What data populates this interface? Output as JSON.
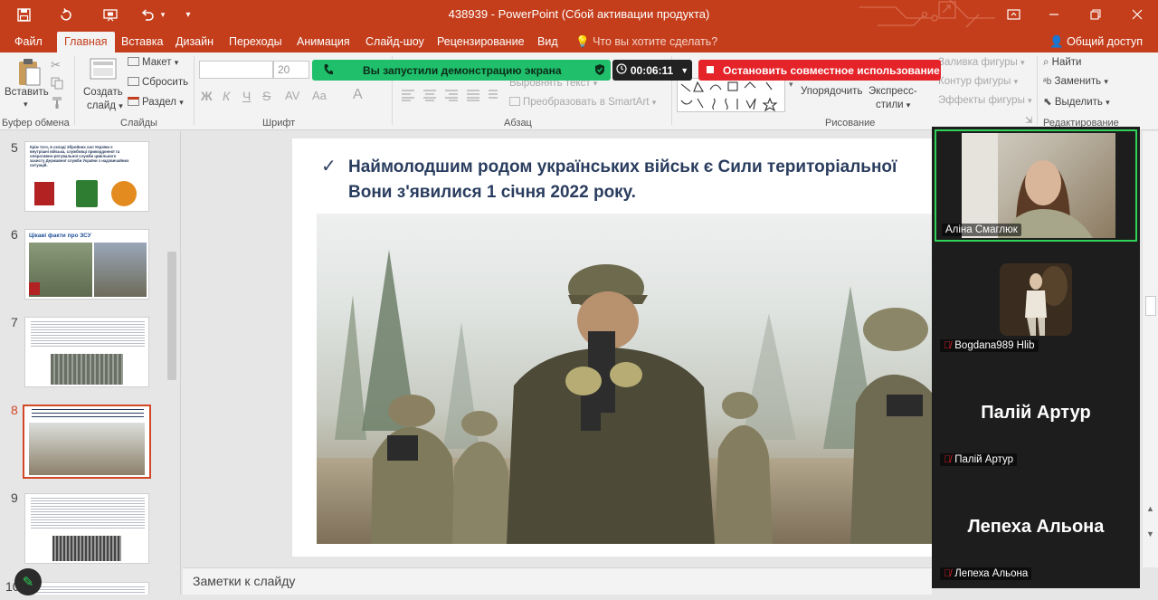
{
  "window": {
    "title": "438939  -  PowerPoint (Сбой активации продукта)",
    "share_access": "Общий доступ"
  },
  "tabs": [
    "Файл",
    "Главная",
    "Вставка",
    "Дизайн",
    "Переходы",
    "Анимация",
    "Слайд-шоу",
    "Рецензирование",
    "Вид"
  ],
  "tell_me": "Что вы хотите сделать?",
  "ribbon": {
    "paste": "Вставить",
    "clipboard": "Буфер обмена",
    "new_slide_line1": "Создать",
    "new_slide_line2": "слайд",
    "layout": "Макет",
    "reset": "Сбросить",
    "section": "Раздел",
    "slides": "Слайды",
    "font_size": "20",
    "font_group": "Шрифт",
    "bold": "Ж",
    "italic": "К",
    "underline": "Ч",
    "text_direction": "Выровнять текст",
    "smartart": "Преобразовать в SmartArt",
    "paragraph": "Абзац",
    "arrange": "Упорядочить",
    "quick_styles_line1": "Экспресс-",
    "quick_styles_line2": "стили",
    "shape_fill": "Заливка фигуры",
    "shape_outline": "Контур фигуры",
    "shape_effects": "Эффекты фигуры",
    "drawing": "Рисование",
    "find": "Найти",
    "replace": "Заменить",
    "select": "Выделить",
    "editing": "Редактирование"
  },
  "share_banner": {
    "message": "Вы запустили демонстрацию экрана",
    "timer": "00:06:11",
    "stop": "Остановить совместное использование"
  },
  "slides_panel": {
    "numbers": [
      "5",
      "6",
      "7",
      "8",
      "9",
      "10"
    ],
    "thumb5_text": "Крім того, в складі Збройних сил України є внутрішні війська, службовці прикордонної та оперативно-рятувальної служби цивільного захисту Державної служби України з надзвичайних ситуацій.",
    "thumb6_title": "Цікаві факти про ЗСУ"
  },
  "slide": {
    "line1": "Наймолодшим родом українських військ є Сили територіальної",
    "line2": "Вони з'явилися 1 січня 2022 року."
  },
  "notes_placeholder": "Заметки к слайду",
  "participants": [
    {
      "name": "Аліна Смаглюк"
    },
    {
      "name": "Bogdana989 Hlib"
    },
    {
      "name": "Палій Артур",
      "big": "Палій Артур"
    },
    {
      "name": "Лепеха Альона",
      "big": "Лепеха Альона"
    }
  ],
  "colors": {
    "accent": "#c43e1c",
    "share_green": "#1fbf6b",
    "stop_red": "#e5242a",
    "active_speaker": "#30d158"
  }
}
